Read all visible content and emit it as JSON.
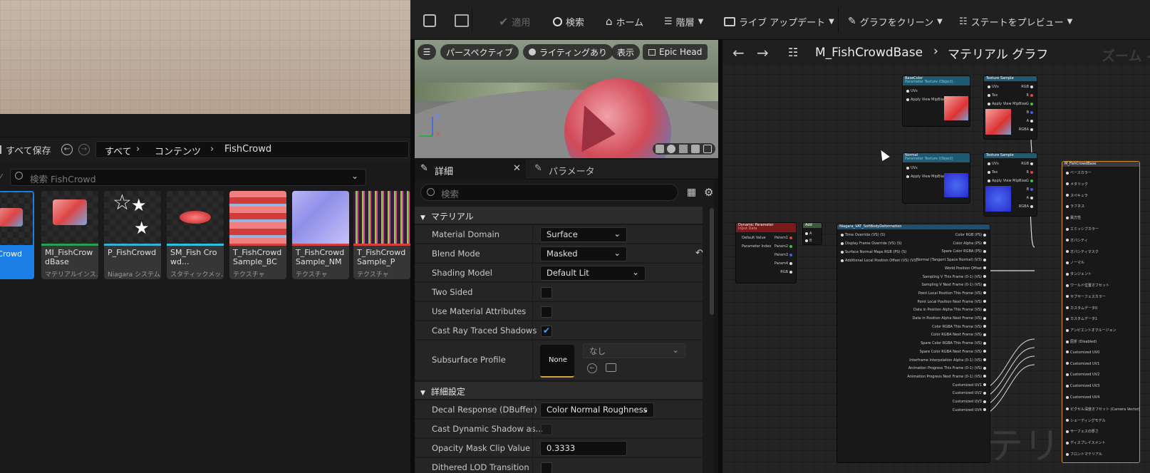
{
  "colors": {
    "accent": "#1a7ee6",
    "checkbox_check": "#4aa3ff"
  },
  "content_browser": {
    "save_all": "すべて保存",
    "breadcrumb": [
      "すべて",
      "コンテンツ",
      "FishCrowd"
    ],
    "search_placeholder": "検索 FishCrowd",
    "assets": [
      {
        "name": "FishCrowd",
        "type": "アル",
        "bar": "#1a7ee6",
        "selected": true
      },
      {
        "name": "MI_FishCrowdBase",
        "type": "マテリアルインス...",
        "bar": "#2aa052"
      },
      {
        "name": "P_FishCrowd",
        "type": "Niagara システム",
        "bar": "#3ab0d0"
      },
      {
        "name": "SM_Fish Crowd...",
        "type": "スタティックメッ...",
        "bar": "#2fc0e0"
      },
      {
        "name": "T_FishCrowd Sample_BC",
        "type": "テクスチャ",
        "bar": "#d04040"
      },
      {
        "name": "T_FishCrowd Sample_NM",
        "type": "テクスチャ",
        "bar": "#d04040"
      },
      {
        "name": "T_FishCrowd Sample_P",
        "type": "テクスチャ",
        "bar": "#d04040"
      }
    ]
  },
  "toolbar": {
    "apply": "適用",
    "search": "検索",
    "home": "ホーム",
    "hierarchy": "階層",
    "live_update": "ライブ アップデート",
    "clean_graph": "グラフをクリーン",
    "preview_state": "ステートをプレビュー"
  },
  "viewport": {
    "perspective": "パースペクティブ",
    "lighting": "ライティングあり",
    "show": "表示",
    "epic_head": "Epic Head",
    "axis_z": "Z",
    "axis_x": "X"
  },
  "details": {
    "tab_details": "詳細",
    "tab_params": "パラメータ",
    "search_placeholder": "検索",
    "section_material": "マテリアル",
    "material_domain_label": "Material Domain",
    "material_domain_value": "Surface",
    "blend_mode_label": "Blend Mode",
    "blend_mode_value": "Masked",
    "shading_model_label": "Shading Model",
    "shading_model_value": "Default Lit",
    "two_sided_label": "Two Sided",
    "use_attr_label": "Use Material Attributes",
    "cast_rt_label": "Cast Ray Traced Shadows",
    "subsurface_label": "Subsurface Profile",
    "subsurface_thumb": "None",
    "subsurface_value": "なし",
    "section_advanced": "詳細設定",
    "decal_label": "Decal Response (DBuffer)",
    "decal_value": "Color Normal Roughness",
    "cast_dyn_label": "Cast Dynamic Shadow as...",
    "opacity_label": "Opacity Mask Clip Value",
    "opacity_value": "0.3333",
    "dither_label": "Dithered LOD Transition"
  },
  "graph": {
    "crumb_material": "M_FishCrowdBase",
    "crumb_graph": "マテリアル グラフ",
    "zoom": "ズーム -",
    "watermark": "マテリアル",
    "nodes": {
      "basecolor": "BaseColor",
      "texsample": "Texture Sample",
      "normal": "Normal",
      "param_source": "Parameter Texture (Object)",
      "dynparam": "Dynamic Parameter",
      "dynparam_sub": "Input Data",
      "add": "Add",
      "vat": "Niagara_VAT_SoftBodyDeformation",
      "result": "M_FishCrowdBase"
    },
    "pins": {
      "uvs": "UVs",
      "tex": "Tex",
      "apply_mip": "Apply View MipBias",
      "rgb": "RGB",
      "r": "R",
      "g": "G",
      "b": "B",
      "a": "A",
      "rgba": "RGBA",
      "default_value": "Default Value",
      "param_index": "Parameter Index",
      "frame": "Frame",
      "offset": "Offset",
      "param1": "Param1",
      "param2": "Param2",
      "param3": "Param3",
      "param4": "Param4",
      "vat_in": [
        "Time Override (VS) (S)",
        "Display Frame Override (VS) (S)",
        "Surface Normal Maps RGB (PS) (S)",
        "Additional Local Position Offset (VS) (V3)"
      ],
      "vat_out": [
        "Color RGB (PS)",
        "Color Alpha (PS)",
        "Spare Color RGBA (PS)",
        "Normal (Tangent Space Normal) (V3)",
        "World Position Offset",
        "Sampling V This Frame (0-1) (VS)",
        "Sampling V Next Frame (0-1) (VS)",
        "Point Local Position This Frame (VS)",
        "Point Local Position Next Frame (VS)",
        "Data in Position Alpha This Frame (VS)",
        "Data in Position Alpha Next Frame (VS)",
        "Color RGBA This Frame (VS)",
        "Color RGBA Next Frame (VS)",
        "Spare Color RGBA This Frame (VS)",
        "Spare Color RGBA Next Frame (VS)",
        "Interframe Interpolation Alpha (0-1) (VS)",
        "Animation Progress This Frame (0-1) (VS)",
        "Animation Progress Next Frame (0-1) (VS)",
        "Customized UV1",
        "Customized UV2",
        "Customized UV3",
        "Customized UV4"
      ],
      "result": [
        "ベースカラー",
        "メタリック",
        "スペキュラ",
        "ラフネス",
        "異方性",
        "エミッシブカラー",
        "オパシティ",
        "オパシティマスク",
        "ノーマル",
        "タンジェント",
        "ワールド位置オフセット",
        "サブサーフェスカラー",
        "カスタムデータ0",
        "カスタムデータ1",
        "アンビエントオクルージョン",
        "屈折 (Disabled)",
        "Customized UV0",
        "Customized UV1",
        "Customized UV2",
        "Customized UV3",
        "Customized UV4",
        "ピクセル深度オフセット (Camera Vector)",
        "シェーディングモデル",
        "サーフェスの厚さ",
        "ディスプレイスメント",
        "フロントマテリアル"
      ]
    }
  }
}
